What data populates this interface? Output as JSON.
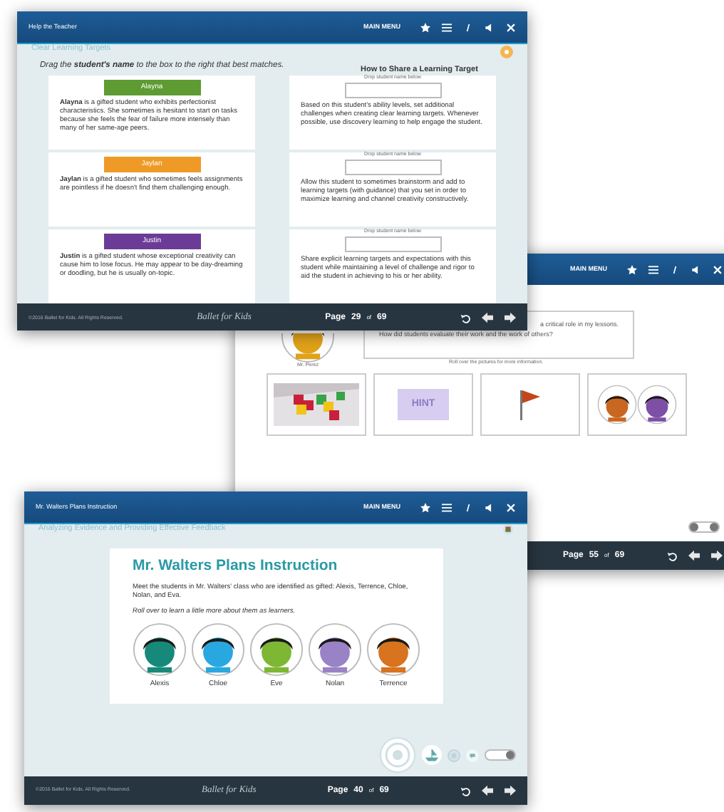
{
  "windows": [
    {
      "kind": "matching",
      "title": "Help the Teacher",
      "menu": "MAIN MENU",
      "section": "Clear Learning Targets",
      "instruction": "Drag the **student's name** to the box to the right that best matches.",
      "target_heading": "How to Share a Learning Target",
      "students": [
        {
          "name": "Alayna",
          "color": "#5e9b32",
          "description": "**Alayna** is a gifted student who exhibits perfectionist characteristics. She sometimes is hesitant to start on tasks because she feels the fear of failure more intensely than many of her same-age peers."
        },
        {
          "name": "Jaylan",
          "color": "#ef9a26",
          "description": "**Jaylan** is a gifted student who sometimes feels assignments are pointless if he doesn't find them challenging enough."
        },
        {
          "name": "Justin",
          "color": "#6b3c97",
          "description": "**Justin** is a gifted student whose exceptional creativity can cause him to lose focus. He may appear to be day-dreaming or doodling, but he is usually on-topic."
        }
      ],
      "strategies": [
        {
          "hint": "Drop student name below",
          "text": "Based on this student's ability levels, set additional challenges when creating clear learning targets. Whenever possible, use discovery learning to help engage the student."
        },
        {
          "hint": "Drop student name below",
          "text": "Allow this student to sometimes brainstorm and add to learning targets (with guidance) that you set in order to maximize learning and channel creativity constructively."
        },
        {
          "hint": "Drop student name below",
          "text": "Share explicit learning targets and expectations with this student while maintaining a level of challenge and rigor to aid the student in achieving to his or her ability."
        }
      ],
      "copyright": "©2016 Ballet for Kids. All Rights Reserved.",
      "logo": "Ballet for Kids",
      "page_label": "Page",
      "page": "29",
      "of": "of",
      "total": "69"
    },
    {
      "kind": "scenario",
      "menu": "MAIN MENU",
      "teacher": "Mr. Perez",
      "question_lines": [
        "a critical role in my lessons.",
        "How did students evaluate their work and the work of others?"
      ],
      "prompt": "Roll over the pictures for more information.",
      "tiles": [
        {
          "kind": "picture"
        },
        {
          "kind": "hint",
          "label": "HINT"
        },
        {
          "kind": "flag"
        },
        {
          "kind": "students",
          "students": [
            {
              "color": "#c9661f"
            },
            {
              "color": "#7d4fa6"
            }
          ]
        }
      ],
      "page_label": "Page",
      "page": "55",
      "of": "of",
      "total": "69"
    },
    {
      "kind": "intro",
      "title": "Mr. Walters Plans Instruction",
      "menu": "MAIN MENU",
      "section": "Analyzing Evidence and Providing Effective Feedback",
      "heading": "Mr. Walters Plans Instruction",
      "paragraph": "Meet the students in Mr. Walters' class who are identified as gifted: Alexis, Terrence, Chloe, Nolan, and Eva.",
      "note": "Roll over to learn a little more about them as learners.",
      "students": [
        {
          "name": "Alexis",
          "color": "#17897a"
        },
        {
          "name": "Chloe",
          "color": "#29a8e0"
        },
        {
          "name": "Eve",
          "color": "#7db733"
        },
        {
          "name": "Nolan",
          "color": "#9a82c6"
        },
        {
          "name": "Terrence",
          "color": "#d8731e"
        }
      ],
      "copyright": "©2016 Ballet for Kids. All Rights Reserved.",
      "logo": "Ballet for Kids",
      "page_label": "Page",
      "page": "40",
      "of": "of",
      "total": "69"
    }
  ]
}
